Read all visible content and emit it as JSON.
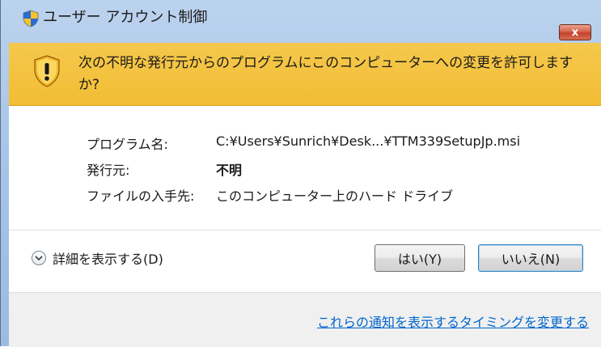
{
  "window": {
    "title": "ユーザー アカウント制御",
    "close_label": "x"
  },
  "banner": {
    "message": "次の不明な発行元からのプログラムにこのコンピューターへの変更を許可しますか?"
  },
  "details": [
    {
      "label": "プログラム名:",
      "value": "C:¥Users¥Sunrich¥Desk...¥TTM339SetupJp.msi",
      "bold": false
    },
    {
      "label": "発行元:",
      "value": "不明",
      "bold": true
    },
    {
      "label": "ファイルの入手先:",
      "value": "このコンピューター上のハード ドライブ",
      "bold": false
    }
  ],
  "buttons": {
    "show_details": "詳細を表示する(D)",
    "yes": "はい(Y)",
    "no": "いいえ(N)"
  },
  "footer": {
    "link": "これらの通知を表示するタイミングを変更する"
  },
  "icons": {
    "title": "uac-shield-icon",
    "banner": "warning-shield-icon",
    "expand": "chevron-down-icon"
  }
}
